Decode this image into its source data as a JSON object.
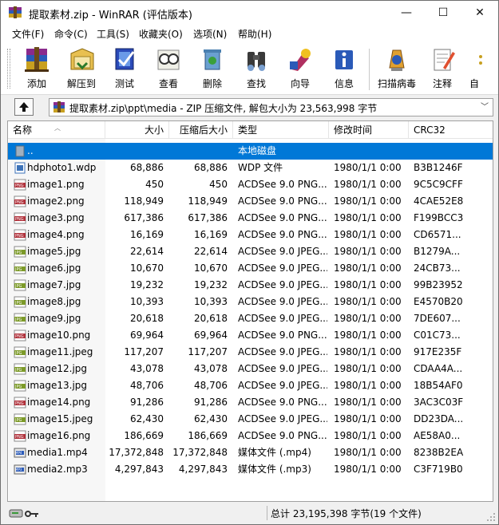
{
  "window": {
    "title": "提取素材.zip - WinRAR (评估版本)",
    "controls": {
      "minimize": "—",
      "maximize": "☐",
      "close": "✕"
    }
  },
  "menu": [
    "文件(F)",
    "命令(C)",
    "工具(S)",
    "收藏夹(O)",
    "选项(N)",
    "帮助(H)"
  ],
  "toolbar": [
    {
      "label": "添加",
      "icon": "add-archive-icon"
    },
    {
      "label": "解压到",
      "icon": "extract-to-icon"
    },
    {
      "label": "测试",
      "icon": "test-icon"
    },
    {
      "label": "查看",
      "icon": "view-icon"
    },
    {
      "label": "删除",
      "icon": "delete-icon"
    },
    {
      "label": "查找",
      "icon": "find-icon"
    },
    {
      "label": "向导",
      "icon": "wizard-icon"
    },
    {
      "label": "信息",
      "icon": "info-icon"
    },
    {
      "label": "扫描病毒",
      "icon": "virus-scan-icon"
    },
    {
      "label": "注释",
      "icon": "comment-icon"
    },
    {
      "label": "自",
      "icon": "sfx-icon"
    }
  ],
  "address": {
    "path": "提取素材.zip\\ppt\\media - ZIP 压缩文件, 解包大小为 23,563,998 字节"
  },
  "columns": [
    "名称",
    "大小",
    "压缩后大小",
    "类型",
    "修改时间",
    "CRC32"
  ],
  "parent_row": {
    "name": "..",
    "type": "本地磁盘"
  },
  "files": [
    {
      "name": "hdphoto1.wdp",
      "size": "68,886",
      "packed": "68,886",
      "type": "WDP 文件",
      "modified": "1980/1/1 0:00",
      "crc": "B3B1246F",
      "kind": "wdp"
    },
    {
      "name": "image1.png",
      "size": "450",
      "packed": "450",
      "type": "ACDSee 9.0 PNG...",
      "modified": "1980/1/1 0:00",
      "crc": "9C5C9CFF",
      "kind": "png"
    },
    {
      "name": "image2.png",
      "size": "118,949",
      "packed": "118,949",
      "type": "ACDSee 9.0 PNG...",
      "modified": "1980/1/1 0:00",
      "crc": "4CAE52E8",
      "kind": "png"
    },
    {
      "name": "image3.png",
      "size": "617,386",
      "packed": "617,386",
      "type": "ACDSee 9.0 PNG...",
      "modified": "1980/1/1 0:00",
      "crc": "F199BCC3",
      "kind": "png"
    },
    {
      "name": "image4.png",
      "size": "16,169",
      "packed": "16,169",
      "type": "ACDSee 9.0 PNG...",
      "modified": "1980/1/1 0:00",
      "crc": "CD6571...",
      "kind": "png"
    },
    {
      "name": "image5.jpg",
      "size": "22,614",
      "packed": "22,614",
      "type": "ACDSee 9.0 JPEG...",
      "modified": "1980/1/1 0:00",
      "crc": "B1279A...",
      "kind": "jpg"
    },
    {
      "name": "image6.jpg",
      "size": "10,670",
      "packed": "10,670",
      "type": "ACDSee 9.0 JPEG...",
      "modified": "1980/1/1 0:00",
      "crc": "24CB73...",
      "kind": "jpg"
    },
    {
      "name": "image7.jpg",
      "size": "19,232",
      "packed": "19,232",
      "type": "ACDSee 9.0 JPEG...",
      "modified": "1980/1/1 0:00",
      "crc": "99B23952",
      "kind": "jpg"
    },
    {
      "name": "image8.jpg",
      "size": "10,393",
      "packed": "10,393",
      "type": "ACDSee 9.0 JPEG...",
      "modified": "1980/1/1 0:00",
      "crc": "E4570B20",
      "kind": "jpg"
    },
    {
      "name": "image9.jpg",
      "size": "20,618",
      "packed": "20,618",
      "type": "ACDSee 9.0 JPEG...",
      "modified": "1980/1/1 0:00",
      "crc": "7DE607...",
      "kind": "jpg"
    },
    {
      "name": "image10.png",
      "size": "69,964",
      "packed": "69,964",
      "type": "ACDSee 9.0 PNG...",
      "modified": "1980/1/1 0:00",
      "crc": "C01C73...",
      "kind": "png"
    },
    {
      "name": "image11.jpeg",
      "size": "117,207",
      "packed": "117,207",
      "type": "ACDSee 9.0 JPEG...",
      "modified": "1980/1/1 0:00",
      "crc": "917E235F",
      "kind": "jpg"
    },
    {
      "name": "image12.jpg",
      "size": "43,078",
      "packed": "43,078",
      "type": "ACDSee 9.0 JPEG...",
      "modified": "1980/1/1 0:00",
      "crc": "CDAA4A...",
      "kind": "jpg"
    },
    {
      "name": "image13.jpg",
      "size": "48,706",
      "packed": "48,706",
      "type": "ACDSee 9.0 JPEG...",
      "modified": "1980/1/1 0:00",
      "crc": "18B54AF0",
      "kind": "jpg"
    },
    {
      "name": "image14.png",
      "size": "91,286",
      "packed": "91,286",
      "type": "ACDSee 9.0 PNG...",
      "modified": "1980/1/1 0:00",
      "crc": "3AC3C03F",
      "kind": "png"
    },
    {
      "name": "image15.jpeg",
      "size": "62,430",
      "packed": "62,430",
      "type": "ACDSee 9.0 JPEG...",
      "modified": "1980/1/1 0:00",
      "crc": "DD23DA...",
      "kind": "jpg"
    },
    {
      "name": "image16.png",
      "size": "186,669",
      "packed": "186,669",
      "type": "ACDSee 9.0 PNG...",
      "modified": "1980/1/1 0:00",
      "crc": "AE58A0...",
      "kind": "png"
    },
    {
      "name": "media1.mp4",
      "size": "17,372,848",
      "packed": "17,372,848",
      "type": "媒体文件 (.mp4)",
      "modified": "1980/1/1 0:00",
      "crc": "8238B2EA",
      "kind": "mp4"
    },
    {
      "name": "media2.mp3",
      "size": "4,297,843",
      "packed": "4,297,843",
      "type": "媒体文件 (.mp3)",
      "modified": "1980/1/1 0:00",
      "crc": "C3F719B0",
      "kind": "mp3"
    }
  ],
  "status": {
    "total": "总计 23,195,398 字节(19 个文件)"
  },
  "colors": {
    "selection": "#0078d7",
    "png_icon": "#b0303a",
    "jpg_icon": "#7c9a28",
    "wdp_icon": "#3b72b8"
  }
}
